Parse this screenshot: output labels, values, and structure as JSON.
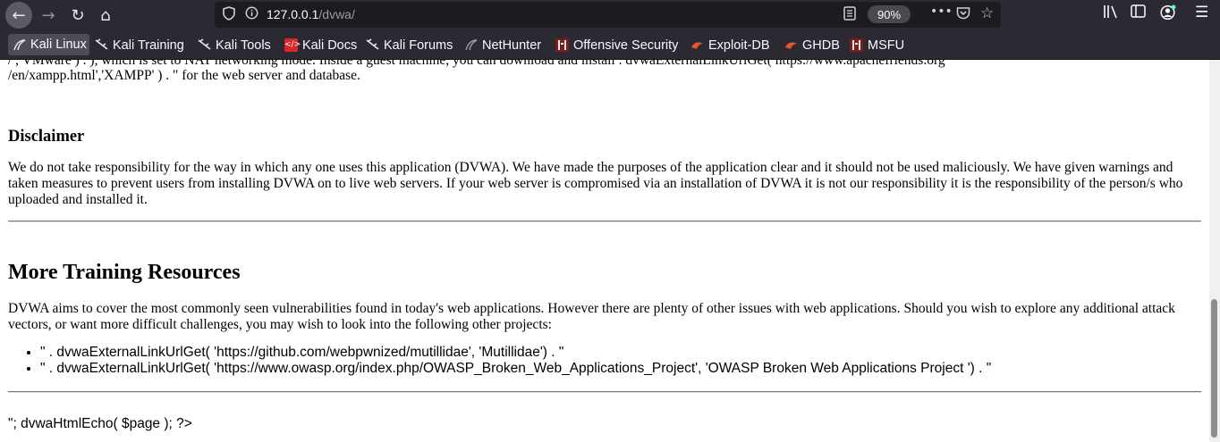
{
  "browser": {
    "nav": {
      "back_icon": "←",
      "forward_icon": "→",
      "reload_icon": "↻",
      "home_icon": "⌂"
    },
    "url": {
      "host": "127.0.0.1",
      "path": "/dvwa/"
    },
    "zoom": "90%",
    "bookmarks": [
      {
        "label": "Kali Linux",
        "icon": "kali-dragon-icon"
      },
      {
        "label": "Kali Training",
        "icon": "kali-dragon-icon"
      },
      {
        "label": "Kali Tools",
        "icon": "kali-dragon-icon"
      },
      {
        "label": "Kali Docs",
        "icon": "kali-docs-icon"
      },
      {
        "label": "Kali Forums",
        "icon": "kali-dragon-icon"
      },
      {
        "label": "NetHunter",
        "icon": "kali-dragon-icon"
      },
      {
        "label": "Offensive Security",
        "icon": "offsec-icon"
      },
      {
        "label": "Exploit-DB",
        "icon": "exploit-db-icon"
      },
      {
        "label": "GHDB",
        "icon": "ghdb-icon"
      },
      {
        "label": "MSFU",
        "icon": "offsec-icon"
      }
    ]
  },
  "page": {
    "top_line1": "/ , VMware ) . ), which is set to NAT networking mode. Inside a guest machine, you can download and install . dvwaExternalLinkUrlGet( https://www.apachefriends.org",
    "top_line2": "/en/xampp.html','XAMPP' ) . \" for the web server and database.",
    "disclaimer_heading": "Disclaimer",
    "disclaimer_text": "We do not take responsibility for the way in which any one uses this application (DVWA). We have made the purposes of the application clear and it should not be used maliciously. We have given warnings and taken measures to prevent users from installing DVWA on to live web servers. If your web server is compromised via an installation of DVWA it is not our responsibility it is the responsibility of the person/s who uploaded and installed it.",
    "more_heading": "More Training Resources",
    "more_text": "DVWA aims to cover the most commonly seen vulnerabilities found in today's web applications. However there are plenty of other issues with web applications. Should you wish to explore any additional attack vectors, or want more difficult challenges, you may wish to look into the following other projects:",
    "resources": [
      "\" . dvwaExternalLinkUrlGet( 'https://github.com/webpwnized/mutillidae', 'Mutillidae') . \"",
      "\" . dvwaExternalLinkUrlGet( 'https://www.owasp.org/index.php/OWASP_Broken_Web_Applications_Project', 'OWASP Broken Web Applications Project ') . \""
    ],
    "footer_echo": "\"; dvwaHtmlEcho( $page ); ?>"
  }
}
